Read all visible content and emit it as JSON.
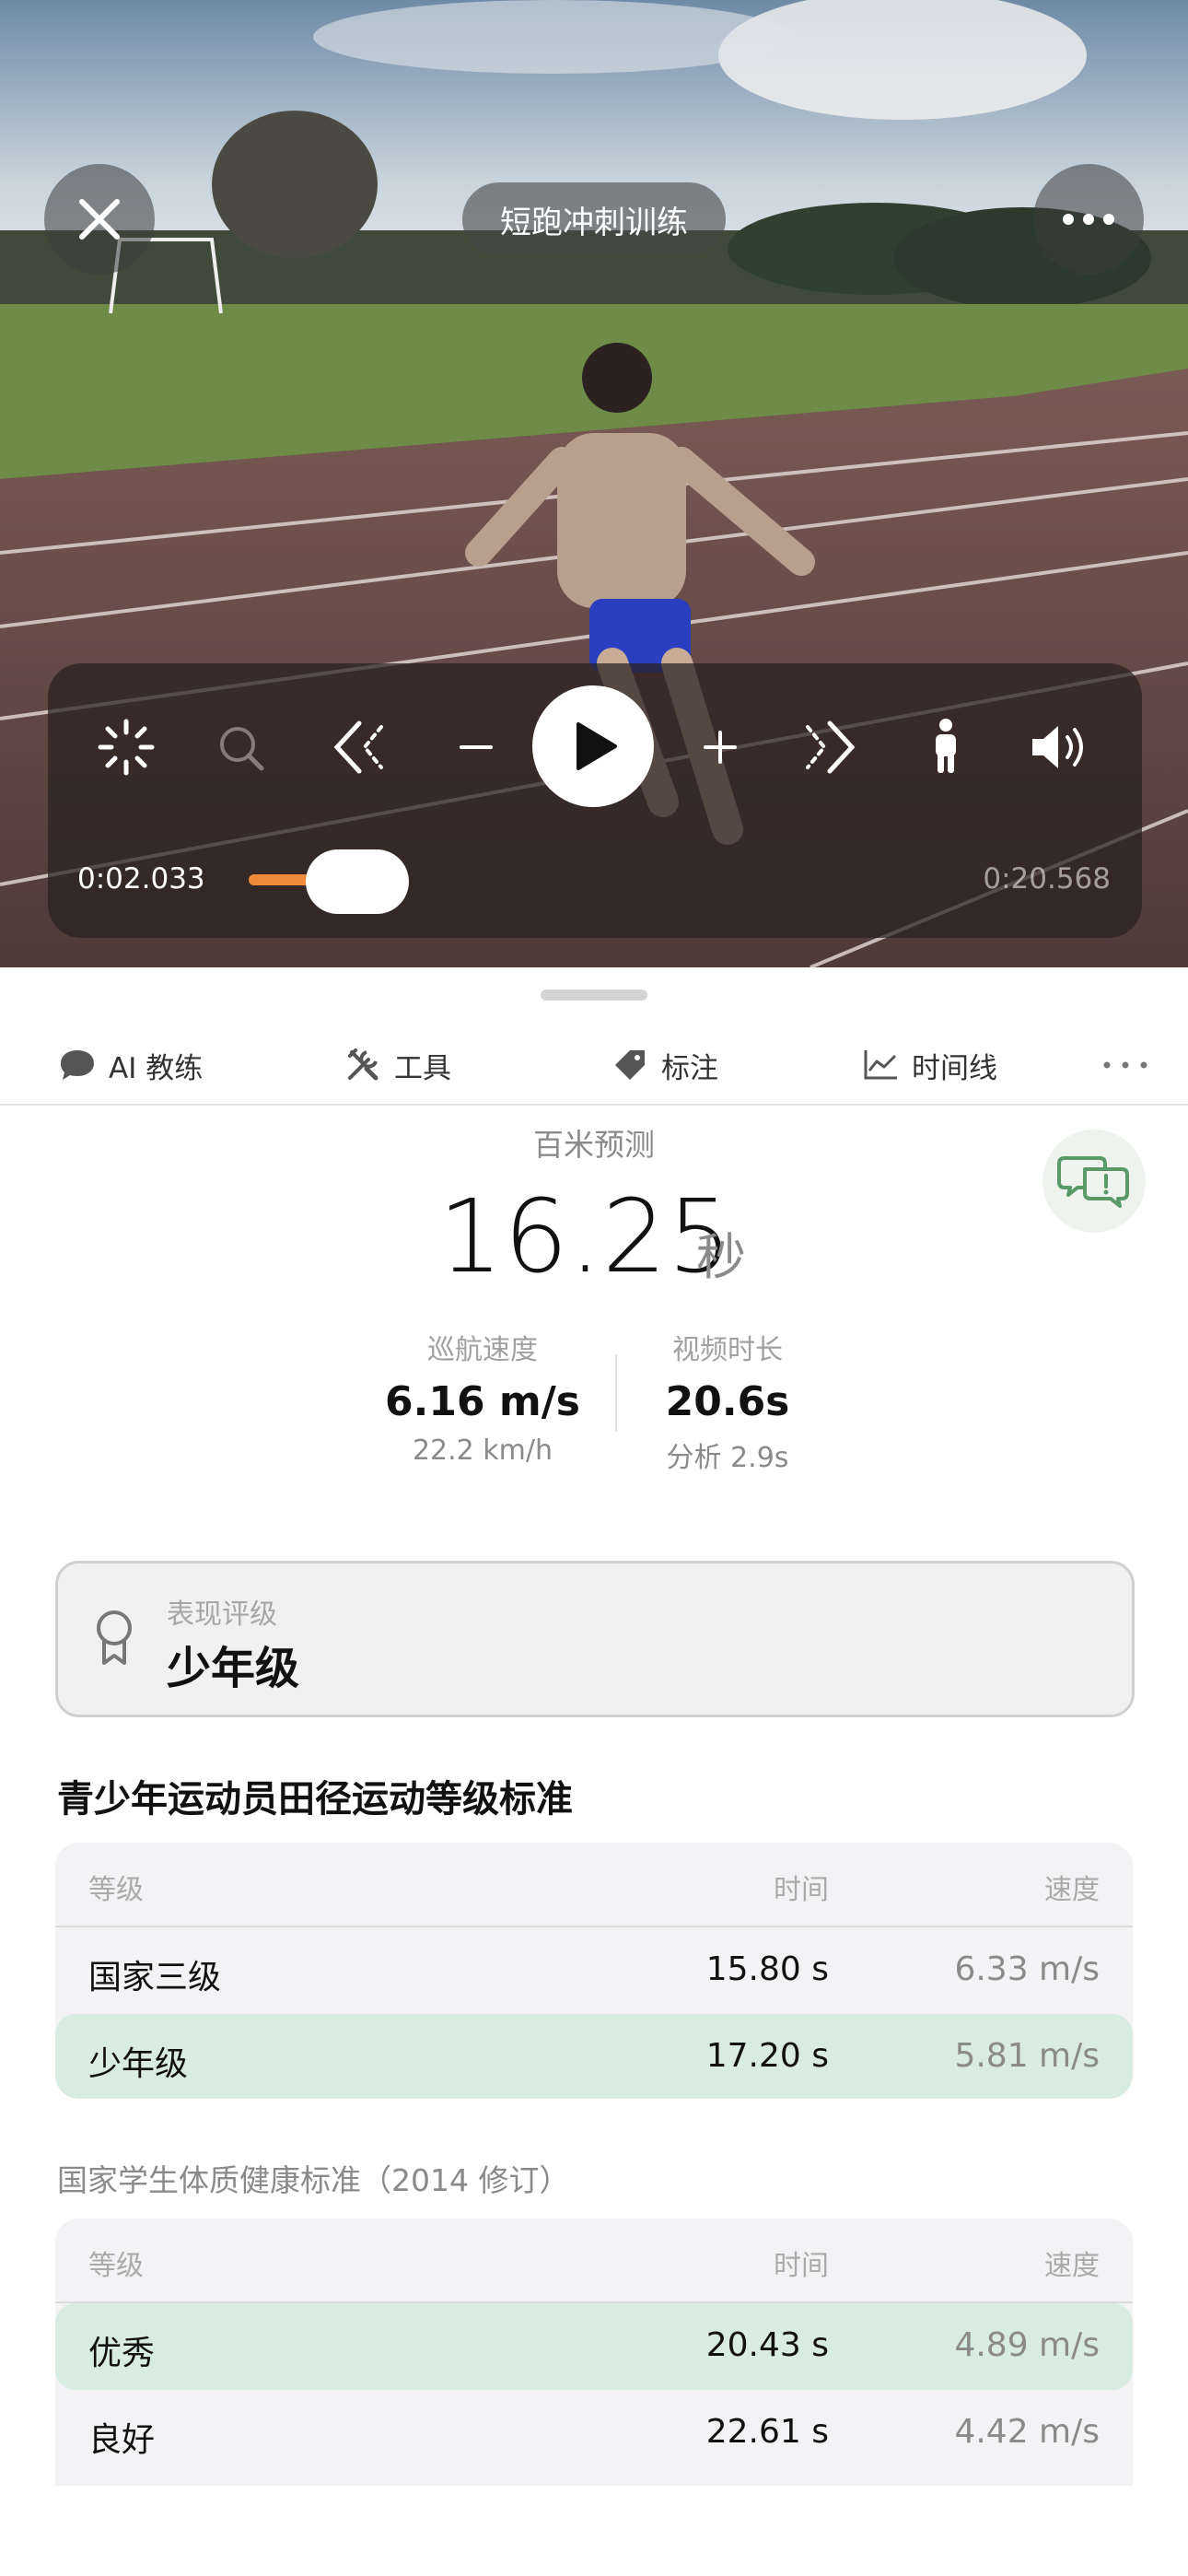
{
  "video": {
    "title": "短跑冲刺训练",
    "current_time": "0:02.033",
    "total_time": "0:20.568",
    "progress": 0.099
  },
  "icons": {
    "close": "close-icon",
    "more": "more-icon",
    "loading": "spinner-icon",
    "zoom": "zoom-icon",
    "rewind": "step-back-icon",
    "minus": "minus-icon",
    "play": "play-icon",
    "plus": "plus-icon",
    "forward": "step-forward-icon",
    "person": "person-icon",
    "volume": "volume-icon",
    "ai": "chat-bubble-icon",
    "tools": "tools-icon",
    "tag": "tag-icon",
    "timeline": "line-chart-icon",
    "feedback": "feedback-icon",
    "award": "award-icon"
  },
  "tabs": [
    {
      "label": "AI 教练"
    },
    {
      "label": "工具"
    },
    {
      "label": "标注"
    },
    {
      "label": "时间线"
    }
  ],
  "prediction": {
    "label": "百米预测",
    "value": "16.25",
    "unit": "秒"
  },
  "stats": {
    "speed": {
      "label": "巡航速度",
      "value": "6.16 m/s",
      "sub": "22.2 km/h"
    },
    "duration": {
      "label": "视频时长",
      "value": "20.6s",
      "sub": "分析 2.9s"
    }
  },
  "grade": {
    "label": "表现评级",
    "value": "少年级"
  },
  "table1": {
    "title": "青少年运动员田径运动等级标准",
    "headers": [
      "等级",
      "时间",
      "速度"
    ],
    "rows": [
      {
        "level": "国家三级",
        "time": "15.80 s",
        "speed": "6.33 m/s"
      },
      {
        "level": "少年级",
        "time": "17.20 s",
        "speed": "5.81 m/s"
      }
    ]
  },
  "table2": {
    "title": "国家学生体质健康标准（2014 修订）",
    "headers": [
      "等级",
      "时间",
      "速度"
    ],
    "rows": [
      {
        "level": "优秀",
        "time": "20.43 s",
        "speed": "4.89 m/s"
      },
      {
        "level": "良好",
        "time": "22.61 s",
        "speed": "4.42 m/s"
      }
    ]
  },
  "colors": {
    "accent": "#f08a3a",
    "highlight_row": "#d9ece1",
    "feedback_green": "#5a9a68"
  }
}
